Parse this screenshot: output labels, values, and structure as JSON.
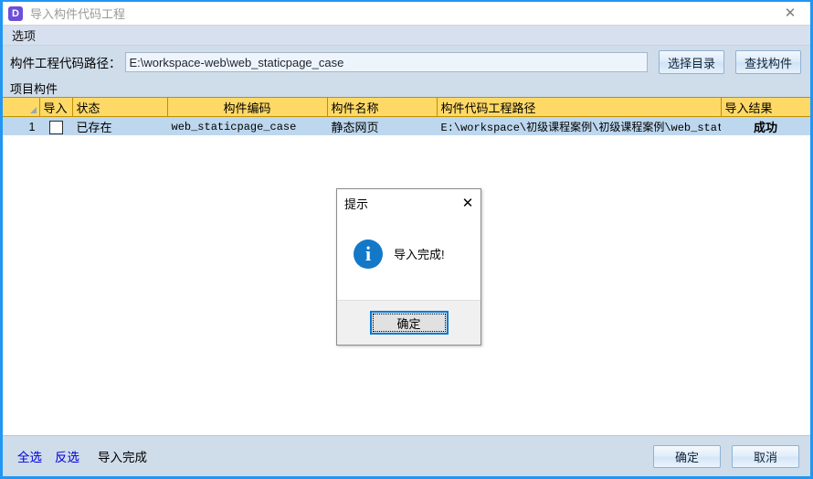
{
  "window": {
    "app_icon_letter": "D",
    "title": "导入构件代码工程",
    "close_icon": "close-icon",
    "close_glyph": "✕",
    "accent_color": "#2196f3"
  },
  "menubar": {
    "items": [
      {
        "label": "选项"
      }
    ]
  },
  "pathbar": {
    "label": "构件工程代码路径：",
    "input_value": "E:\\workspace-web\\web_staticpage_case",
    "input_placeholder": "",
    "buttons": [
      {
        "label": "选择目录"
      },
      {
        "label": "查找构件"
      }
    ]
  },
  "section": {
    "label": "项目构件"
  },
  "grid": {
    "header_bg": "#ffd966",
    "selected_row_bg": "#bdd7ee",
    "columns": [
      {
        "key": "rownum",
        "label": "",
        "align": "right"
      },
      {
        "key": "import",
        "label": "导入",
        "align": "left"
      },
      {
        "key": "status",
        "label": "状态",
        "align": "left"
      },
      {
        "key": "code",
        "label": "构件编码",
        "align": "center"
      },
      {
        "key": "name",
        "label": "构件名称",
        "align": "left"
      },
      {
        "key": "path",
        "label": "构件代码工程路径",
        "align": "left"
      },
      {
        "key": "result",
        "label": "导入结果",
        "align": "left"
      }
    ],
    "rows": [
      {
        "rownum": "1",
        "import_checked": false,
        "status": "已存在",
        "code": "web_staticpage_case",
        "name": "静态网页",
        "path": "E:\\workspace\\初级课程案例\\初级课程案例\\web_staticp",
        "result": "成功",
        "result_color": "#1a7a1a"
      }
    ]
  },
  "footer": {
    "links": [
      {
        "label": "全选"
      },
      {
        "label": "反选"
      }
    ],
    "note": "导入完成",
    "buttons": [
      {
        "label": "确定"
      },
      {
        "label": "取消"
      }
    ]
  },
  "dialog": {
    "title": "提示",
    "close_glyph": "✕",
    "icon": "info-icon",
    "icon_letter": "i",
    "icon_color": "#1478c8",
    "message": "导入完成!",
    "ok_label": "确定"
  }
}
